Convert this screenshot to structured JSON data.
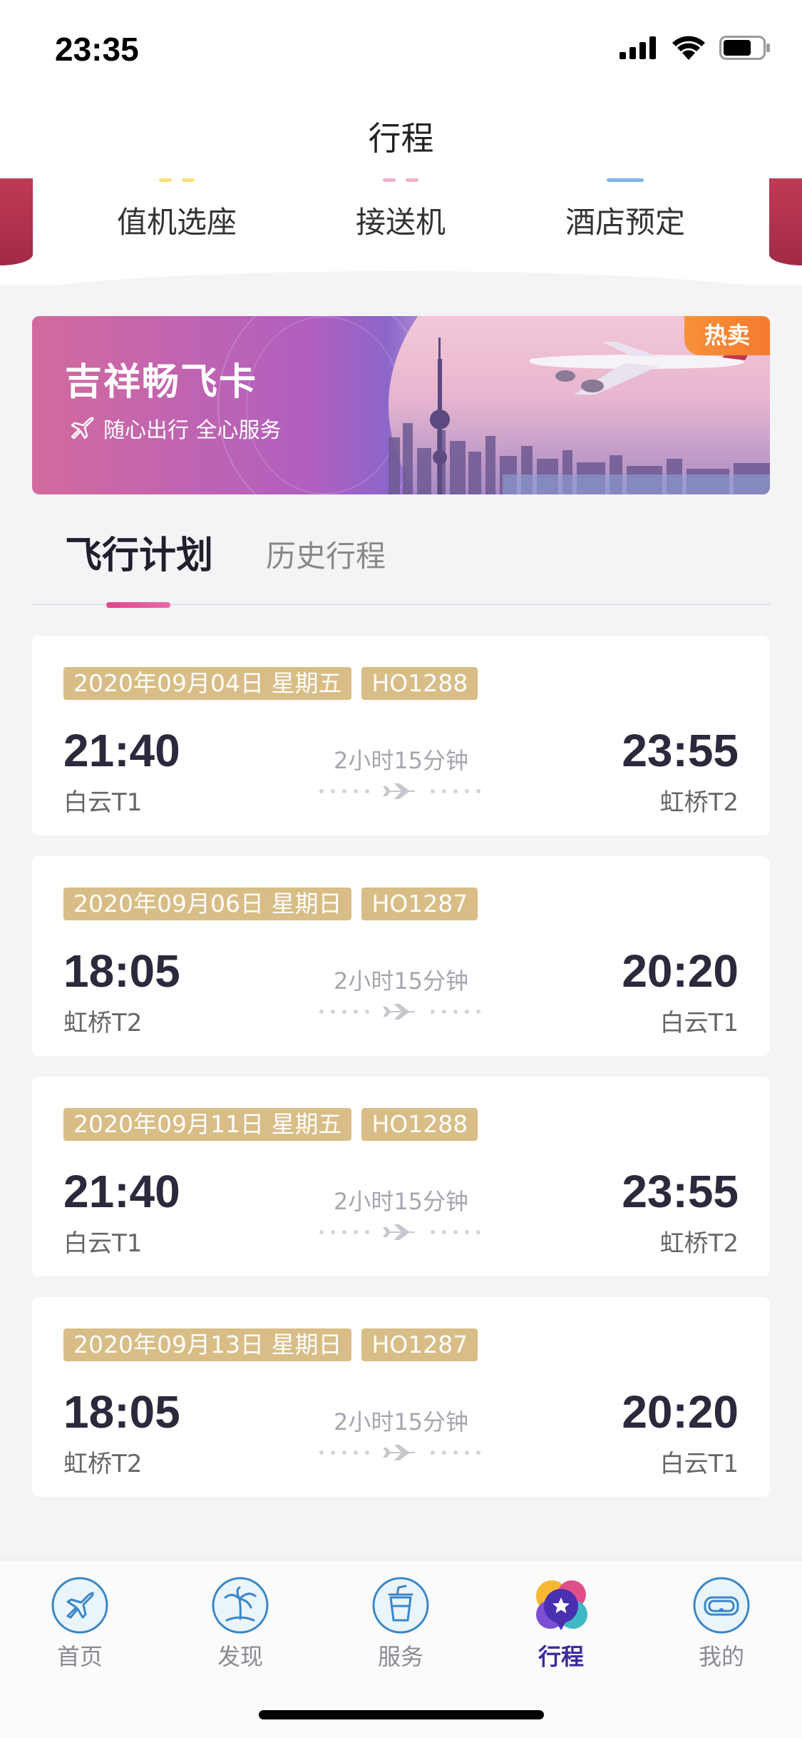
{
  "status_bar": {
    "time": "23:35"
  },
  "nav": {
    "title": "行程"
  },
  "quick_services": [
    {
      "label": "值机选座",
      "accent": "#f5e27a"
    },
    {
      "label": "接送机",
      "accent": "#f2b3c4"
    },
    {
      "label": "酒店预定",
      "accent": "#7fb3ea"
    }
  ],
  "banner": {
    "title": "吉祥畅飞卡",
    "subtitle": "随心出行 全心服务",
    "badge": "热卖"
  },
  "tabs": {
    "active": "飞行计划",
    "inactive": "历史行程"
  },
  "flights": [
    {
      "date": "2020年09月04日 星期五",
      "flight_no": "HO1288",
      "dep_time": "21:40",
      "dep_airport": "白云T1",
      "duration": "2小时15分钟",
      "arr_time": "23:55",
      "arr_airport": "虹桥T2"
    },
    {
      "date": "2020年09月06日 星期日",
      "flight_no": "HO1287",
      "dep_time": "18:05",
      "dep_airport": "虹桥T2",
      "duration": "2小时15分钟",
      "arr_time": "20:20",
      "arr_airport": "白云T1"
    },
    {
      "date": "2020年09月11日 星期五",
      "flight_no": "HO1288",
      "dep_time": "21:40",
      "dep_airport": "白云T1",
      "duration": "2小时15分钟",
      "arr_time": "23:55",
      "arr_airport": "虹桥T2"
    },
    {
      "date": "2020年09月13日 星期日",
      "flight_no": "HO1287",
      "dep_time": "18:05",
      "dep_airport": "虹桥T2",
      "duration": "2小时15分钟",
      "arr_time": "20:20",
      "arr_airport": "白云T1"
    }
  ],
  "tabbar": [
    {
      "label": "首页",
      "icon": "plane-icon"
    },
    {
      "label": "发现",
      "icon": "palm-tree-icon"
    },
    {
      "label": "服务",
      "icon": "cup-icon"
    },
    {
      "label": "行程",
      "icon": "itinerary-star-icon",
      "active": true
    },
    {
      "label": "我的",
      "icon": "vr-glasses-icon"
    }
  ],
  "colors": {
    "tag_gold": "#d8bd86",
    "tab_underline": "#e0468a",
    "active_tab": "#3c2b9c",
    "badge_orange": "#f7913b",
    "tab_icon_blue": "#3a86c8"
  }
}
